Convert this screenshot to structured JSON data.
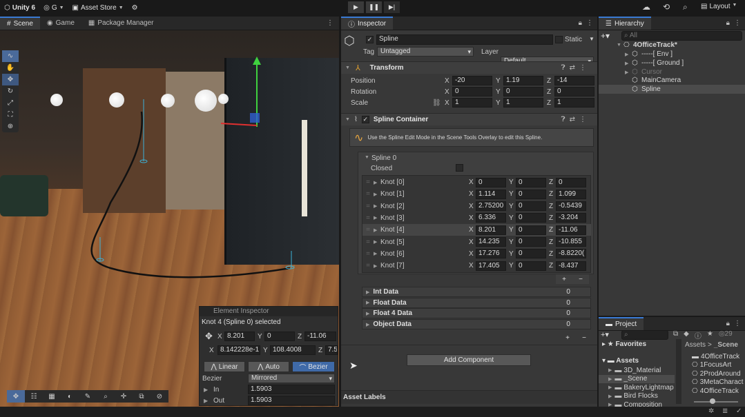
{
  "topbar": {
    "app": "Unity 6",
    "account": "G",
    "asset_store": "Asset Store",
    "layout": "Layout"
  },
  "scene": {
    "tabs": [
      "Scene",
      "Game",
      "Package Manager"
    ]
  },
  "element_inspector": {
    "title": "Element Inspector",
    "selected": "Knot 4 (Spline 0) selected",
    "x": "8.201",
    "y": "0",
    "z": "-11.06",
    "x2": "8.142228e-1:",
    "y2": "108.4008",
    "z2": "7.5",
    "modes": [
      "Linear",
      "Auto",
      "Bezier"
    ],
    "bezier_label": "Bezier",
    "bezier_value": "Mirrored",
    "in_label": "In",
    "in_value": "1.5903",
    "out_label": "Out",
    "out_value": "1.5903"
  },
  "inspector": {
    "tab": "Inspector",
    "object_name": "Spline",
    "static_label": "Static",
    "tag_label": "Tag",
    "tag_value": "Untagged",
    "layer_label": "Layer",
    "layer_value": "Default",
    "transform": {
      "title": "Transform",
      "position_label": "Position",
      "rotation_label": "Rotation",
      "scale_label": "Scale",
      "position": [
        "-20",
        "1.19",
        "-14"
      ],
      "rotation": [
        "0",
        "0",
        "0"
      ],
      "scale": [
        "1",
        "1",
        "1"
      ]
    },
    "spline_container": {
      "title": "Spline Container",
      "help": "Use the Spline Edit Mode in the Scene Tools Overlay to edit this Spline.",
      "spline_label": "Spline 0",
      "closed_label": "Closed",
      "knots": [
        {
          "label": "Knot [0]",
          "x": "0",
          "y": "0",
          "z": "0"
        },
        {
          "label": "Knot [1]",
          "x": "1.114",
          "y": "0",
          "z": "1.099"
        },
        {
          "label": "Knot [2]",
          "x": "2.75200",
          "y": "0",
          "z": "-0.5439"
        },
        {
          "label": "Knot [3]",
          "x": "6.336",
          "y": "0",
          "z": "-3.204"
        },
        {
          "label": "Knot [4]",
          "x": "8.201",
          "y": "0",
          "z": "-11.06"
        },
        {
          "label": "Knot [5]",
          "x": "14.235",
          "y": "0",
          "z": "-10.855"
        },
        {
          "label": "Knot [6]",
          "x": "17.276",
          "y": "0",
          "z": "-8.8220("
        },
        {
          "label": "Knot [7]",
          "x": "17.405",
          "y": "0",
          "z": "-8.437"
        }
      ],
      "data_rows": [
        {
          "label": "Int Data",
          "value": "0"
        },
        {
          "label": "Float Data",
          "value": "0"
        },
        {
          "label": "Float 4 Data",
          "value": "0"
        },
        {
          "label": "Object Data",
          "value": "0"
        }
      ]
    },
    "add_component": "Add Component",
    "asset_labels": "Asset Labels"
  },
  "hierarchy": {
    "tab": "Hierarchy",
    "search": "All",
    "items": [
      {
        "label": "4OfficeTrack*"
      },
      {
        "label": "-----[ Env ]"
      },
      {
        "label": "-----[ Ground ]"
      },
      {
        "label": "Cursor"
      },
      {
        "label": "MainCamera"
      },
      {
        "label": "Spline"
      }
    ]
  },
  "project": {
    "tab": "Project",
    "favorites": "Favorites",
    "assets": "Assets",
    "folders": [
      "3D_Material",
      "_Scene",
      "BakeryLightmap",
      "Bird Flocks",
      "Composition"
    ],
    "breadcrumb": [
      "Assets",
      ">",
      "_Scene"
    ],
    "files": [
      "4OfficeTrack",
      "1FocusArt",
      "2ProdAround",
      "3MetaCharact",
      "4OfficeTrack"
    ],
    "count": "29"
  }
}
